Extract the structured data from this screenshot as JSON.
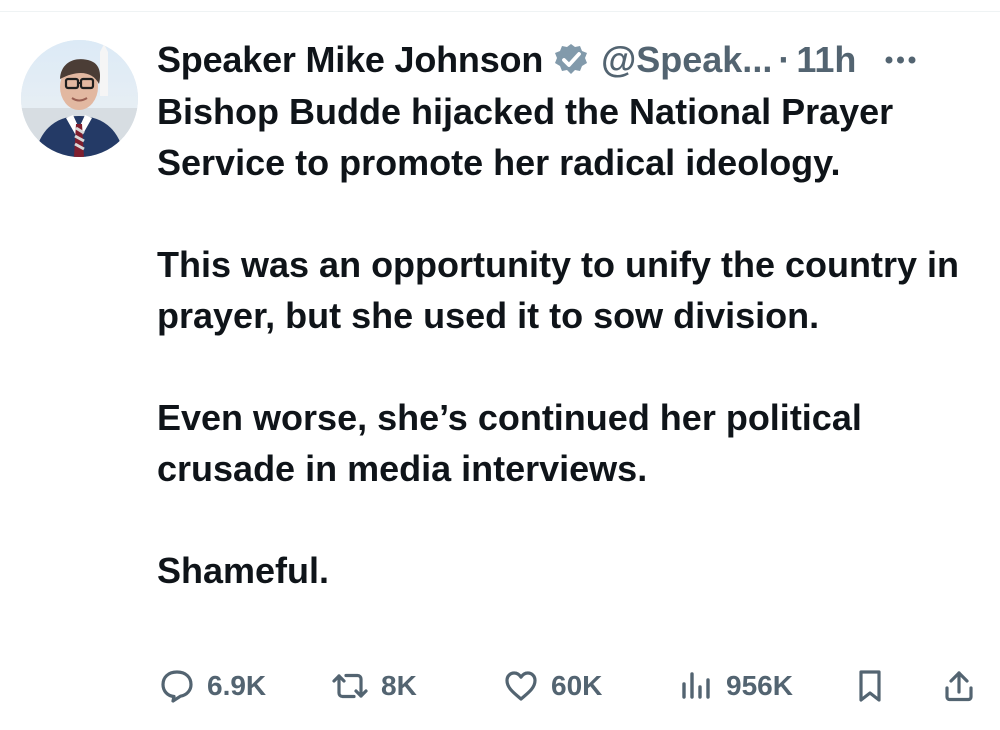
{
  "tweet": {
    "display_name": "Speaker Mike Johnson",
    "handle": "@Speak...",
    "separator": "·",
    "time": "11h",
    "paragraphs": [
      "Bishop Budde hijacked the National Prayer Service to promote her radical ideology.",
      "This was an opportunity to unify the country in prayer, but she used it to sow division.",
      "Even worse, she’s continued her political crusade in media interviews.",
      "Shameful."
    ],
    "icons": {
      "avatar": "profile-photo",
      "verified": "verified-badge-icon",
      "more": "more-options-icon",
      "reply": "reply-icon",
      "repost": "repost-icon",
      "like": "like-icon",
      "views": "views-icon",
      "bookmark": "bookmark-icon",
      "share": "share-icon"
    }
  },
  "actions": {
    "replies": "6.9K",
    "reposts": "8K",
    "likes": "60K",
    "views": "956K"
  },
  "colors": {
    "text": "#0f1419",
    "secondary": "#536471",
    "verified_badge": "#829aab",
    "divider": "#eff3f4"
  }
}
